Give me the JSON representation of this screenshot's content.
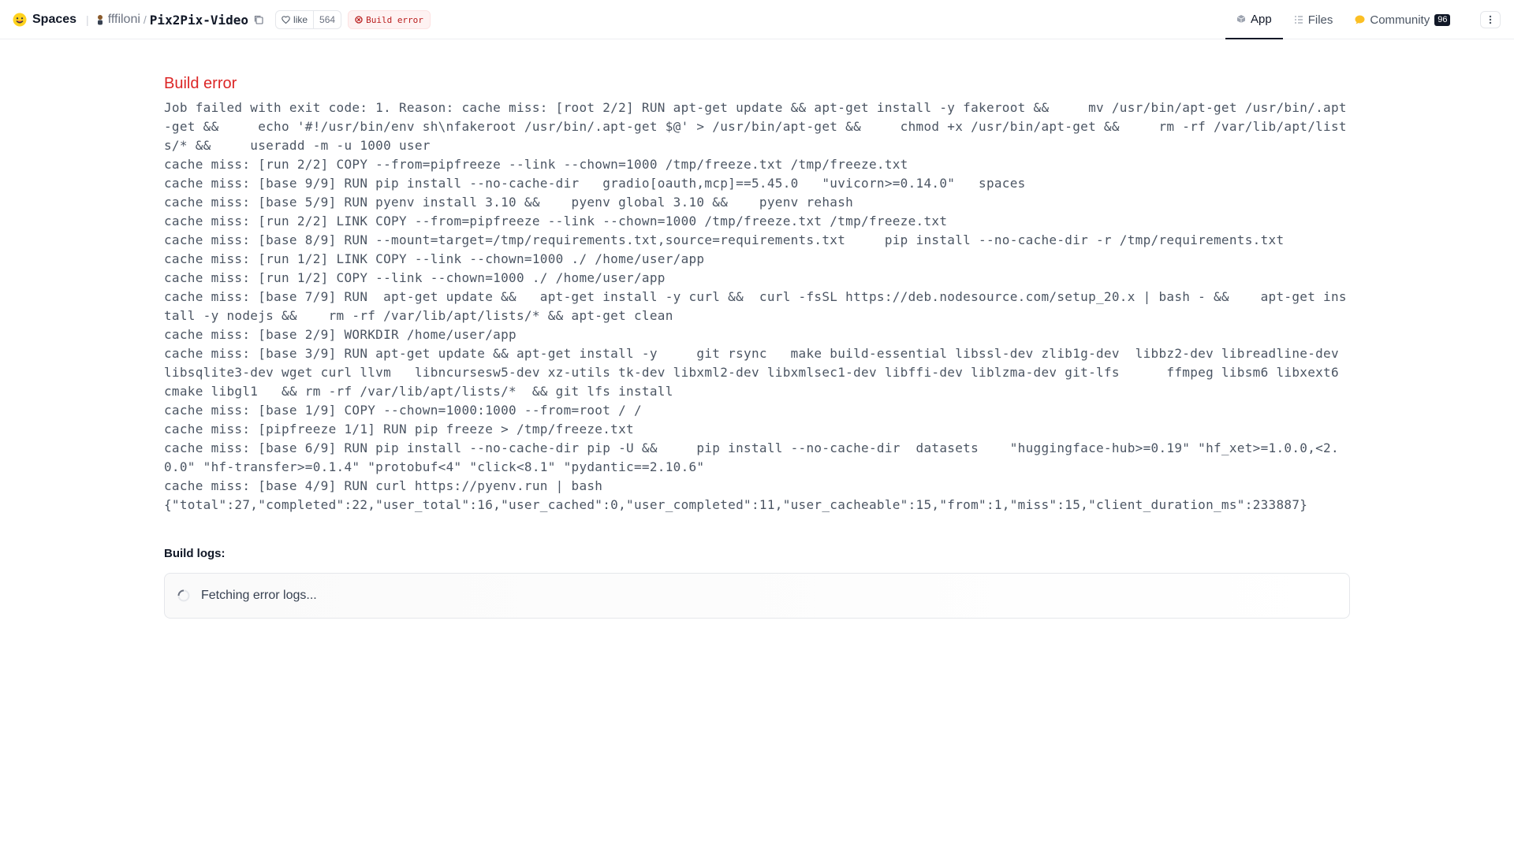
{
  "header": {
    "brand": "Spaces",
    "owner": "fffiloni",
    "repo": "Pix2Pix-Video",
    "like_label": "like",
    "like_count": "564",
    "status": "Build error",
    "tabs": [
      {
        "label": "App",
        "icon": "cube-icon",
        "active": true
      },
      {
        "label": "Files",
        "icon": "files-icon",
        "active": false
      },
      {
        "label": "Community",
        "icon": "community-icon",
        "active": false,
        "count": "96"
      }
    ]
  },
  "main": {
    "error_title": "Build error",
    "error_log": "Job failed with exit code: 1. Reason: cache miss: [root 2/2] RUN apt-get update && apt-get install -y fakeroot &&     mv /usr/bin/apt-get /usr/bin/.apt-get &&     echo '#!/usr/bin/env sh\\nfakeroot /usr/bin/.apt-get $@' > /usr/bin/apt-get &&     chmod +x /usr/bin/apt-get &&     rm -rf /var/lib/apt/lists/* &&     useradd -m -u 1000 user\ncache miss: [run 2/2] COPY --from=pipfreeze --link --chown=1000 /tmp/freeze.txt /tmp/freeze.txt\ncache miss: [base 9/9] RUN pip install --no-cache-dir   gradio[oauth,mcp]==5.45.0   \"uvicorn>=0.14.0\"   spaces\ncache miss: [base 5/9] RUN pyenv install 3.10 &&    pyenv global 3.10 &&    pyenv rehash\ncache miss: [run 2/2] LINK COPY --from=pipfreeze --link --chown=1000 /tmp/freeze.txt /tmp/freeze.txt\ncache miss: [base 8/9] RUN --mount=target=/tmp/requirements.txt,source=requirements.txt     pip install --no-cache-dir -r /tmp/requirements.txt\ncache miss: [run 1/2] LINK COPY --link --chown=1000 ./ /home/user/app\ncache miss: [run 1/2] COPY --link --chown=1000 ./ /home/user/app\ncache miss: [base 7/9] RUN  apt-get update &&   apt-get install -y curl &&  curl -fsSL https://deb.nodesource.com/setup_20.x | bash - &&    apt-get install -y nodejs &&    rm -rf /var/lib/apt/lists/* && apt-get clean\ncache miss: [base 2/9] WORKDIR /home/user/app\ncache miss: [base 3/9] RUN apt-get update && apt-get install -y     git rsync   make build-essential libssl-dev zlib1g-dev  libbz2-dev libreadline-dev libsqlite3-dev wget curl llvm   libncursesw5-dev xz-utils tk-dev libxml2-dev libxmlsec1-dev libffi-dev liblzma-dev git-lfs      ffmpeg libsm6 libxext6 cmake libgl1   && rm -rf /var/lib/apt/lists/*  && git lfs install\ncache miss: [base 1/9] COPY --chown=1000:1000 --from=root / /\ncache miss: [pipfreeze 1/1] RUN pip freeze > /tmp/freeze.txt\ncache miss: [base 6/9] RUN pip install --no-cache-dir pip -U &&     pip install --no-cache-dir  datasets    \"huggingface-hub>=0.19\" \"hf_xet>=1.0.0,<2.0.0\" \"hf-transfer>=0.1.4\" \"protobuf<4\" \"click<8.1\" \"pydantic==2.10.6\"\ncache miss: [base 4/9] RUN curl https://pyenv.run | bash\n{\"total\":27,\"completed\":22,\"user_total\":16,\"user_cached\":0,\"user_completed\":11,\"user_cacheable\":15,\"from\":1,\"miss\":15,\"client_duration_ms\":233887}",
    "logs_label": "Build logs:",
    "logs_status": "Fetching error logs..."
  }
}
